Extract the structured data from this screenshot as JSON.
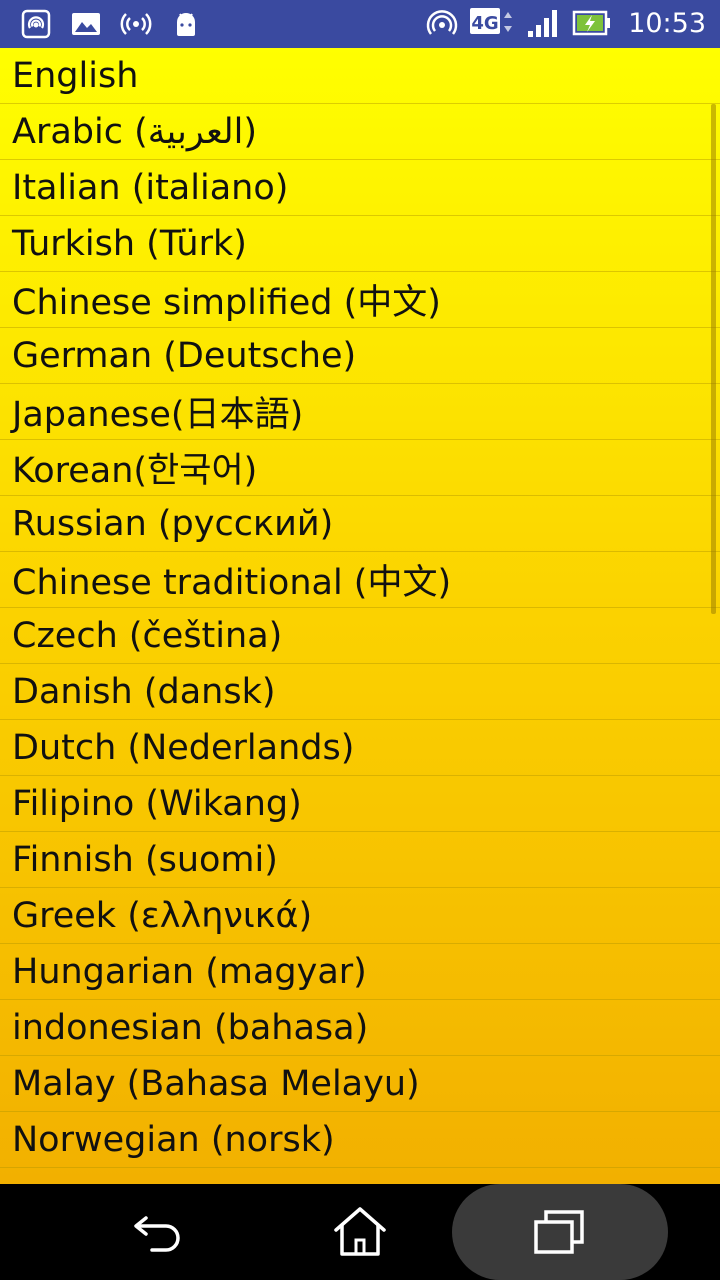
{
  "status_bar": {
    "time": "10:53",
    "network": "4G",
    "icons_left": [
      "hotspot-icon",
      "gallery-icon",
      "broadcast-icon",
      "android-icon"
    ],
    "icons_right": [
      "hotspot-icon",
      "network-4g-icon",
      "signal-icon",
      "battery-charging-icon"
    ]
  },
  "languages": [
    "English",
    "Arabic (العربية)",
    "Italian (italiano)",
    "Turkish (Türk)",
    "Chinese simplified (中文)",
    "German (Deutsche)",
    "Japanese(日本語)",
    "Korean(한국어)",
    "Russian (русский)",
    "Chinese traditional (中文)",
    "Czech (čeština)",
    "Danish (dansk)",
    "Dutch (Nederlands)",
    "Filipino (Wikang)",
    "Finnish (suomi)",
    "Greek (ελληνικά)",
    "Hungarian (magyar)",
    "indonesian (bahasa)",
    "Malay (Bahasa Melayu)",
    "Norwegian (norsk)"
  ],
  "colors": {
    "status_bar": "#3a4aa0",
    "list_top": "#ffff00",
    "list_bottom": "#f2b000"
  }
}
